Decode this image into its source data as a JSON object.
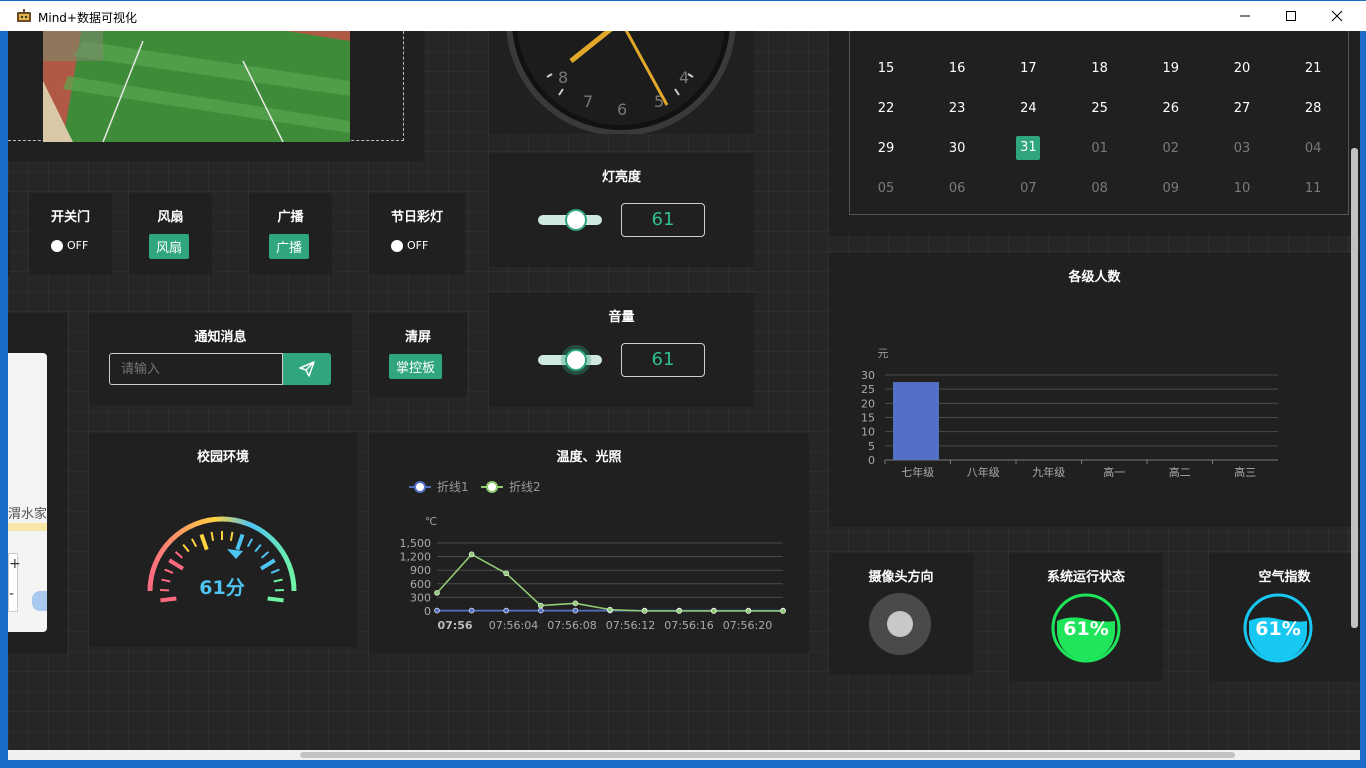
{
  "window": {
    "title": "Mind+数据可视化"
  },
  "switches": {
    "door": {
      "title": "开关门",
      "state": "OFF"
    },
    "fan": {
      "title": "风扇",
      "button": "风扇"
    },
    "broadcast": {
      "title": "广播",
      "button": "广播"
    },
    "festival": {
      "title": "节日彩灯",
      "state": "OFF"
    }
  },
  "brightness": {
    "title": "灯亮度",
    "value": "61"
  },
  "volume": {
    "title": "音量",
    "value": "61"
  },
  "notice": {
    "title": "通知消息",
    "placeholder": "请输入"
  },
  "clear": {
    "title": "清屏",
    "button": "掌控板"
  },
  "map": {
    "label": "渭水家",
    "zoom_in": "+",
    "zoom_out": "-"
  },
  "clock": {
    "numerals": [
      "8",
      "7",
      "6",
      "5",
      "4"
    ]
  },
  "calendar": {
    "rows": [
      [
        "15",
        "16",
        "17",
        "18",
        "19",
        "20",
        "21"
      ],
      [
        "22",
        "23",
        "24",
        "25",
        "26",
        "27",
        "28"
      ],
      [
        "29",
        "30",
        "31",
        "01",
        "02",
        "03",
        "04"
      ],
      [
        "05",
        "06",
        "07",
        "08",
        "09",
        "10",
        "11"
      ]
    ],
    "selected": "31"
  },
  "campus": {
    "title": "校园环境",
    "gauge_value": 61,
    "gauge_label": "61分"
  },
  "linechart": {
    "title": "温度、光照"
  },
  "chart_data": [
    {
      "type": "line",
      "title": "温度、光照",
      "ylabel": "℃",
      "ylim": [
        0,
        1500
      ],
      "yticks": [
        "0",
        "300",
        "600",
        "900",
        "1,200",
        "1,500"
      ],
      "xticks": [
        "07:56",
        "07:56:04",
        "07:56:08",
        "07:56:12",
        "07:56:16",
        "07:56:20"
      ],
      "legend": "top-left",
      "series": [
        {
          "name": "折线1",
          "color": "#5470c6",
          "values": [
            10,
            10,
            10,
            10,
            10,
            10,
            10,
            10,
            10,
            10,
            10
          ]
        },
        {
          "name": "折线2",
          "color": "#91cc75",
          "values": [
            400,
            1250,
            830,
            120,
            170,
            30,
            0,
            0,
            0,
            0,
            0
          ]
        }
      ]
    },
    {
      "type": "bar",
      "title": "各级人数",
      "ylabel": "元",
      "ylim": [
        0,
        30
      ],
      "yticks": [
        "0",
        "5",
        "10",
        "15",
        "20",
        "25",
        "30"
      ],
      "categories": [
        "七年级",
        "八年级",
        "九年级",
        "高一",
        "高二",
        "高三"
      ],
      "values": [
        27.5,
        0,
        0,
        0,
        0,
        0
      ],
      "color": "#5470c6"
    }
  ],
  "camera": {
    "title": "摄像头方向"
  },
  "system": {
    "title": "系统运行状态",
    "value": "61%",
    "color": "#1ee55a"
  },
  "air": {
    "title": "空气指数",
    "value": "61%",
    "color": "#17c8f2"
  }
}
